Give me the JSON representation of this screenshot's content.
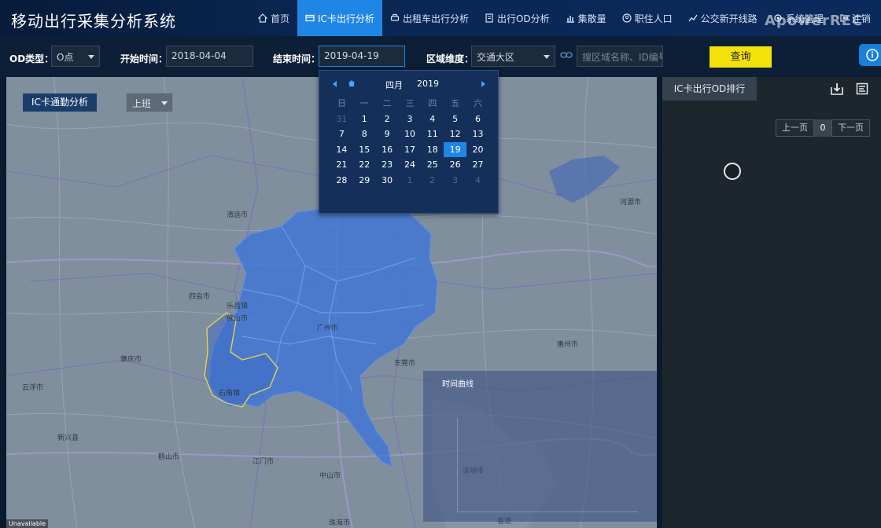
{
  "app_title": "移动出行采集分析系统",
  "nav": [
    {
      "label": "首页",
      "icon": "home-icon",
      "active": false
    },
    {
      "label": "IC卡出行分析",
      "icon": "card-icon",
      "active": true
    },
    {
      "label": "出租车出行分析",
      "icon": "taxi-icon",
      "active": false
    },
    {
      "label": "出行OD分析",
      "icon": "document-icon",
      "active": false
    },
    {
      "label": "集散量",
      "icon": "bar-chart-icon",
      "active": false
    },
    {
      "label": "职住人口",
      "icon": "person-icon",
      "active": false
    },
    {
      "label": "公交新开线路",
      "icon": "trend-line-icon",
      "active": false
    },
    {
      "label": "系统管理",
      "icon": "settings-icon",
      "active": false
    },
    {
      "label": "注销",
      "icon": "logout-icon",
      "active": false
    }
  ],
  "watermark": "ApowerREC",
  "filters": {
    "od_type_label": "OD类型：",
    "od_type_value": "O点",
    "start_label": "开始时间：",
    "start_value": "2018-04-04",
    "end_label": "结束时间：",
    "end_value": "2019-04-19",
    "region_label": "区域维度：",
    "region_value": "交通大区",
    "search_placeholder": "搜区域名称、ID编号",
    "query_button": "查询"
  },
  "calendar": {
    "month": "四月",
    "year": "2019",
    "weekdays": [
      "日",
      "一",
      "二",
      "三",
      "四",
      "五",
      "六"
    ],
    "weeks": [
      [
        {
          "d": "31",
          "o": true
        },
        {
          "d": "1"
        },
        {
          "d": "2"
        },
        {
          "d": "3"
        },
        {
          "d": "4"
        },
        {
          "d": "5"
        },
        {
          "d": "6"
        }
      ],
      [
        {
          "d": "7"
        },
        {
          "d": "8"
        },
        {
          "d": "9"
        },
        {
          "d": "10"
        },
        {
          "d": "11"
        },
        {
          "d": "12"
        },
        {
          "d": "13"
        }
      ],
      [
        {
          "d": "14"
        },
        {
          "d": "15"
        },
        {
          "d": "16"
        },
        {
          "d": "17"
        },
        {
          "d": "18"
        },
        {
          "d": "19",
          "s": true
        },
        {
          "d": "20"
        }
      ],
      [
        {
          "d": "21"
        },
        {
          "d": "22"
        },
        {
          "d": "23"
        },
        {
          "d": "24"
        },
        {
          "d": "25"
        },
        {
          "d": "26"
        },
        {
          "d": "27"
        }
      ],
      [
        {
          "d": "28"
        },
        {
          "d": "29"
        },
        {
          "d": "30"
        },
        {
          "d": "1",
          "o": true
        },
        {
          "d": "2",
          "o": true
        },
        {
          "d": "3",
          "o": true
        },
        {
          "d": "4",
          "o": true
        }
      ]
    ]
  },
  "map": {
    "analysis_tab": "IC卡通勤分析",
    "period_value": "上班",
    "unavailable": "Unavailable",
    "time_curve_title": "时间曲线",
    "labels": [
      {
        "t": "清远市"
      },
      {
        "t": "东莞市"
      },
      {
        "t": "惠州市"
      },
      {
        "t": "河源市"
      },
      {
        "t": "肇庆市"
      },
      {
        "t": "云浮市"
      },
      {
        "t": "中山市"
      },
      {
        "t": "江门市"
      },
      {
        "t": "珠海市"
      },
      {
        "t": "佛山市"
      },
      {
        "t": "广州市"
      },
      {
        "t": "深圳市"
      },
      {
        "t": "香港"
      },
      {
        "t": "四会市"
      },
      {
        "t": "鹤山市"
      },
      {
        "t": "新兴县"
      },
      {
        "t": "乐昌镇"
      },
      {
        "t": "石角镇"
      }
    ]
  },
  "right_panel": {
    "tab": "IC卡出行OD排行",
    "prev": "上一页",
    "page": "0",
    "next": "下一页"
  }
}
